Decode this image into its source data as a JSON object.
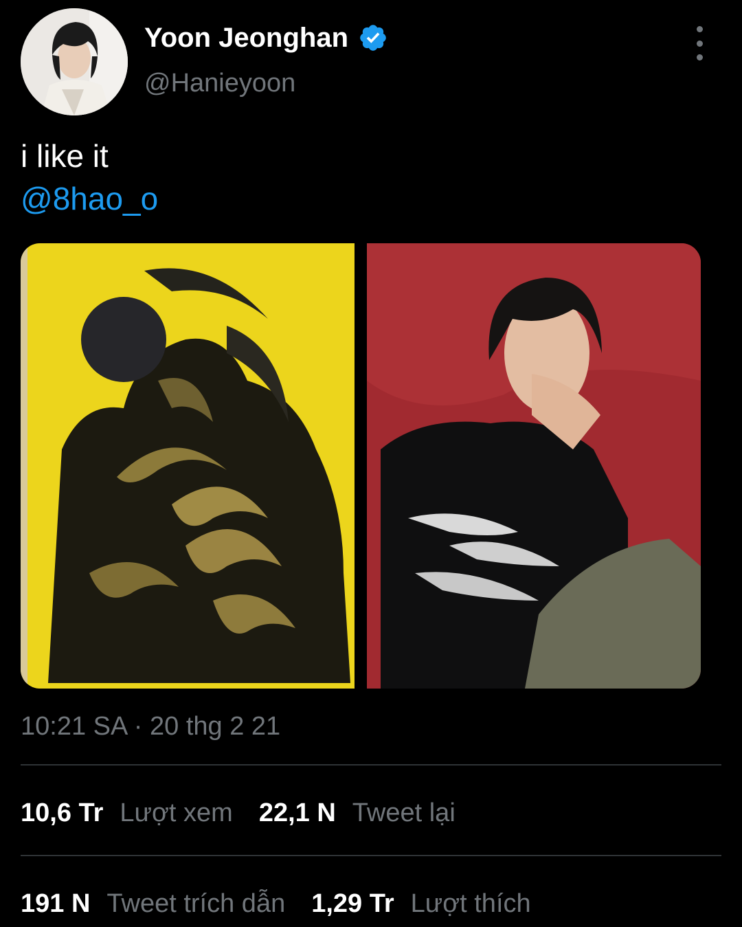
{
  "author": {
    "display_name": "Yoon Jeonghan",
    "handle": "@Hanieyoon",
    "verified_icon": "verified-badge-icon",
    "avatar_icon": "profile-photo"
  },
  "menu": {
    "icon": "more-vertical-icon"
  },
  "tweet": {
    "text": "i like it",
    "mention": "@8hao_o",
    "media": [
      {
        "name": "abstract-painting-photo"
      },
      {
        "name": "portrait-photo"
      }
    ]
  },
  "timestamp": "10:21 SA · 20 thg 2 21",
  "stats": {
    "views": {
      "value": "10,6 Tr",
      "label": "Lượt xem"
    },
    "retweets": {
      "value": "22,1 N",
      "label": "Tweet lại"
    },
    "quotes": {
      "value": "191 N",
      "label": "Tweet trích dẫn"
    },
    "likes": {
      "value": "1,29 Tr",
      "label": "Lượt thích"
    }
  },
  "colors": {
    "background": "#000000",
    "accent": "#1d9bf0",
    "secondary_text": "#71767b",
    "divider": "#2f3336"
  }
}
